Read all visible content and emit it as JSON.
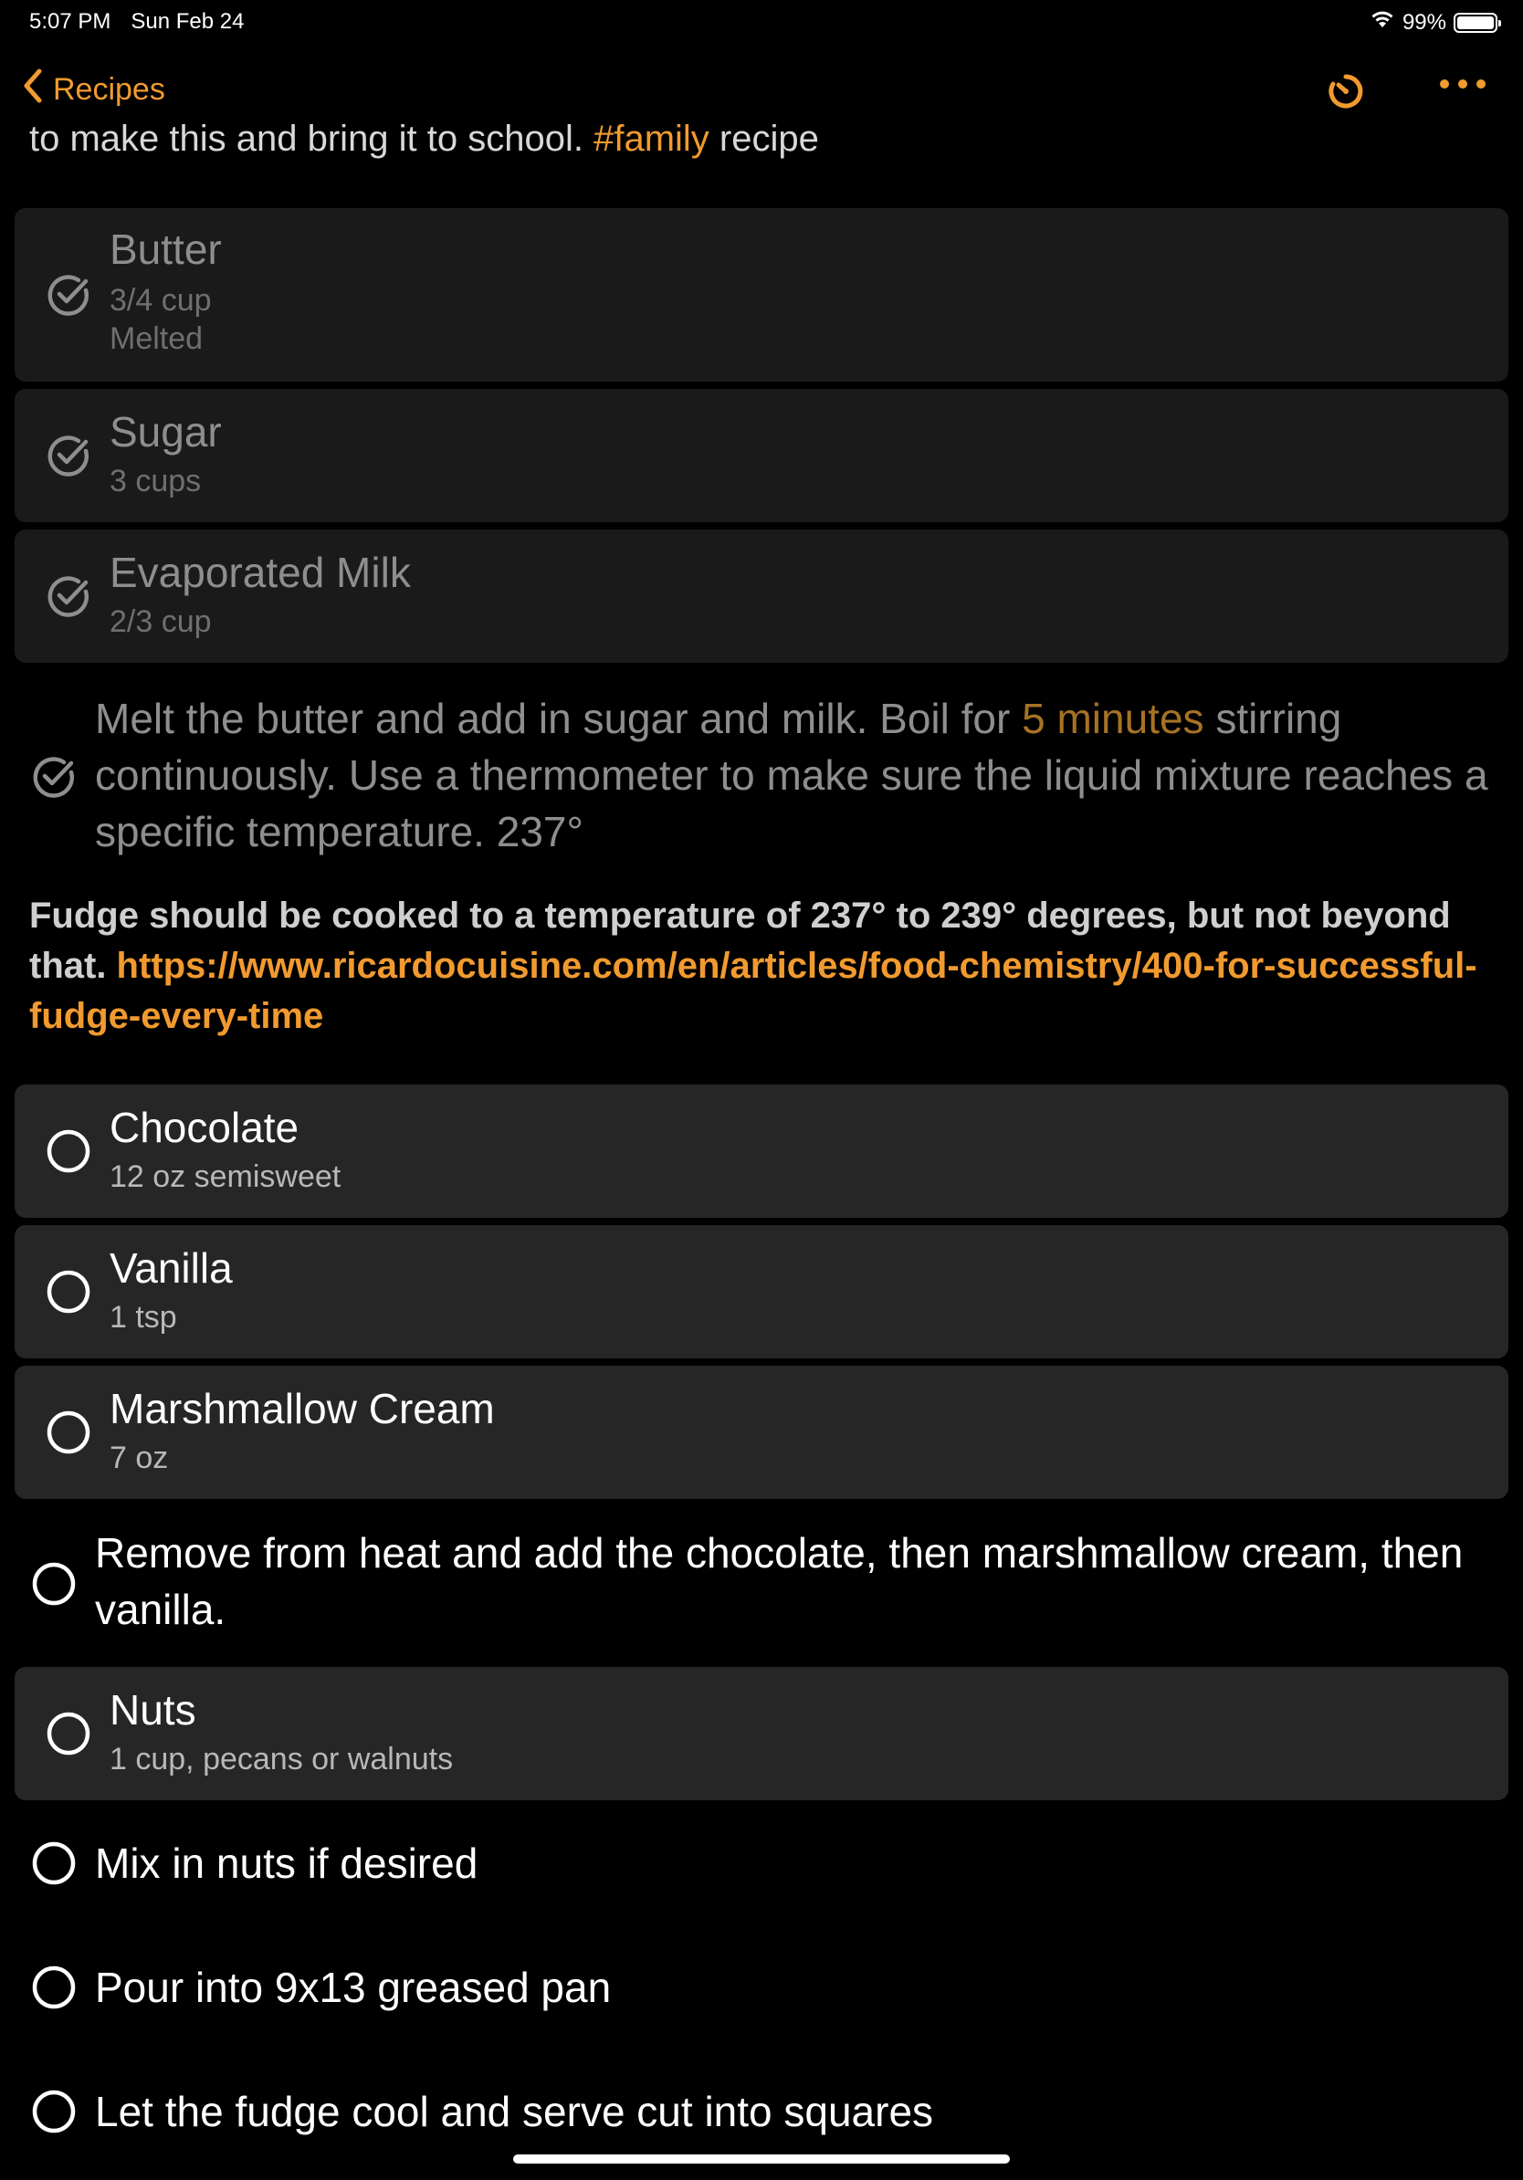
{
  "status_bar": {
    "time": "5:07 PM",
    "date": "Sun Feb 24",
    "battery_percent": "99%",
    "battery_level": 0.99
  },
  "nav": {
    "back_label": "Recipes"
  },
  "intro": {
    "text_before": "to make this and bring it to school. ",
    "tag": "#family",
    "text_after": " recipe"
  },
  "ingredients_done": [
    {
      "name": "Butter",
      "amount": "3/4 cup",
      "note": "Melted"
    },
    {
      "name": "Sugar",
      "amount": "3 cups"
    },
    {
      "name": "Evaporated Milk",
      "amount": "2/3 cup"
    }
  ],
  "step1": {
    "part1": "Melt the butter and add in sugar and milk. Boil for ",
    "timer": "5 minutes",
    "part2": " stirring continuously. Use a thermometer to make sure the liquid mixture reaches a specific temperature. 237°"
  },
  "note": {
    "text": "Fudge should be cooked to a temperature of 237° to 239° degrees, but not beyond that. ",
    "link": "https://www.ricardocuisine.com/en/articles/food-chemistry/400-for-successful-fudge-every-time"
  },
  "ingredients_open": [
    {
      "name": "Chocolate",
      "amount": "12 oz semisweet"
    },
    {
      "name": "Vanilla",
      "amount": "1 tsp"
    },
    {
      "name": "Marshmallow Cream",
      "amount": "7 oz"
    }
  ],
  "step2": {
    "text": "Remove from heat and add the chocolate, then marshmallow cream, then vanilla."
  },
  "ingredient_nuts": {
    "name": "Nuts",
    "amount": "1 cup, pecans or walnuts"
  },
  "steps_final": [
    "Mix in nuts if desired",
    "Pour into 9x13 greased pan",
    "Let the fudge cool and serve cut into squares"
  ],
  "colors": {
    "accent": "#F19A2F",
    "background": "#000000",
    "card": "#262626",
    "card_done": "#1a1a1a"
  }
}
